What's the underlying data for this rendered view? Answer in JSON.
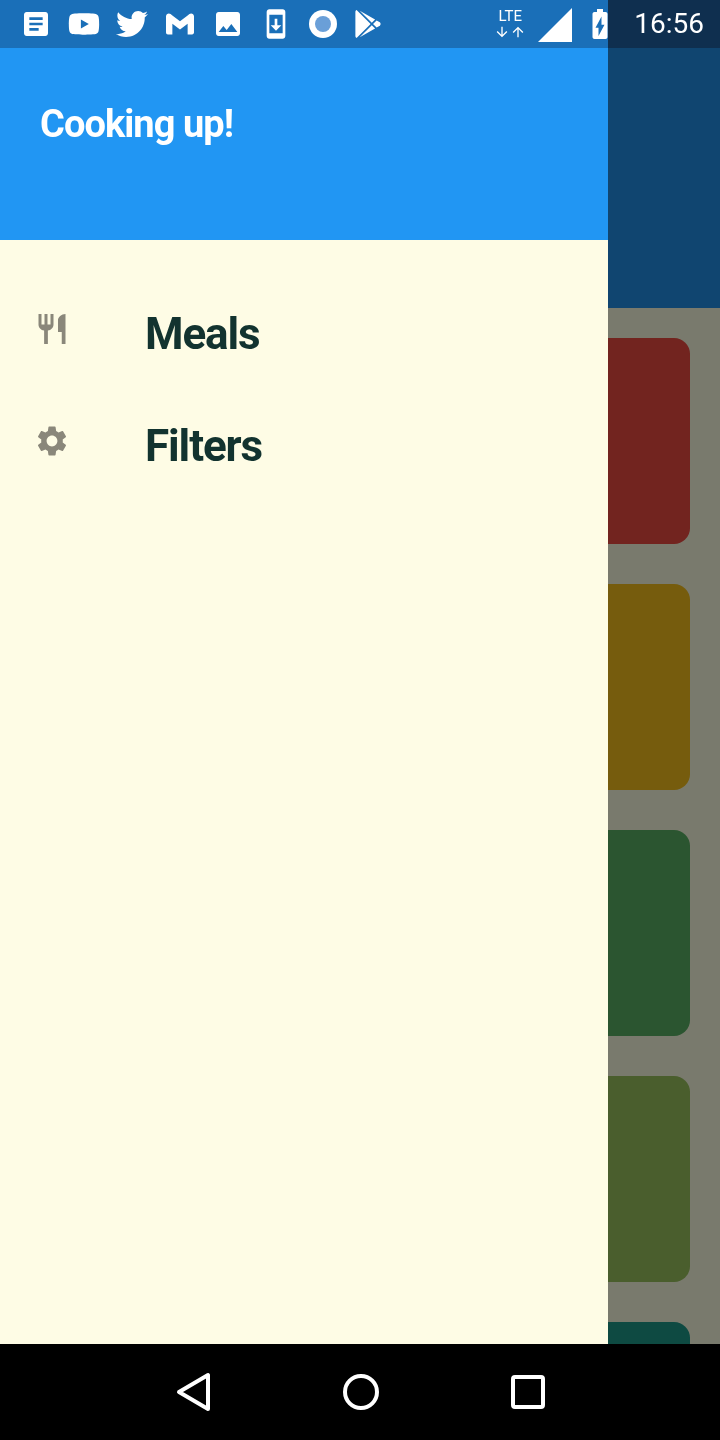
{
  "status_bar": {
    "network": "LTE",
    "time": "16:56"
  },
  "drawer": {
    "title": "Cooking up!",
    "items": [
      {
        "kind": "meals",
        "label": "Meals"
      },
      {
        "kind": "filters",
        "label": "Filters"
      }
    ]
  },
  "background_cards": [
    {
      "color": "#72241f"
    },
    {
      "color": "#765c0d"
    },
    {
      "color": "#2b5530"
    },
    {
      "color": "#4a5e2d"
    },
    {
      "color": "#0e4a42"
    }
  ]
}
